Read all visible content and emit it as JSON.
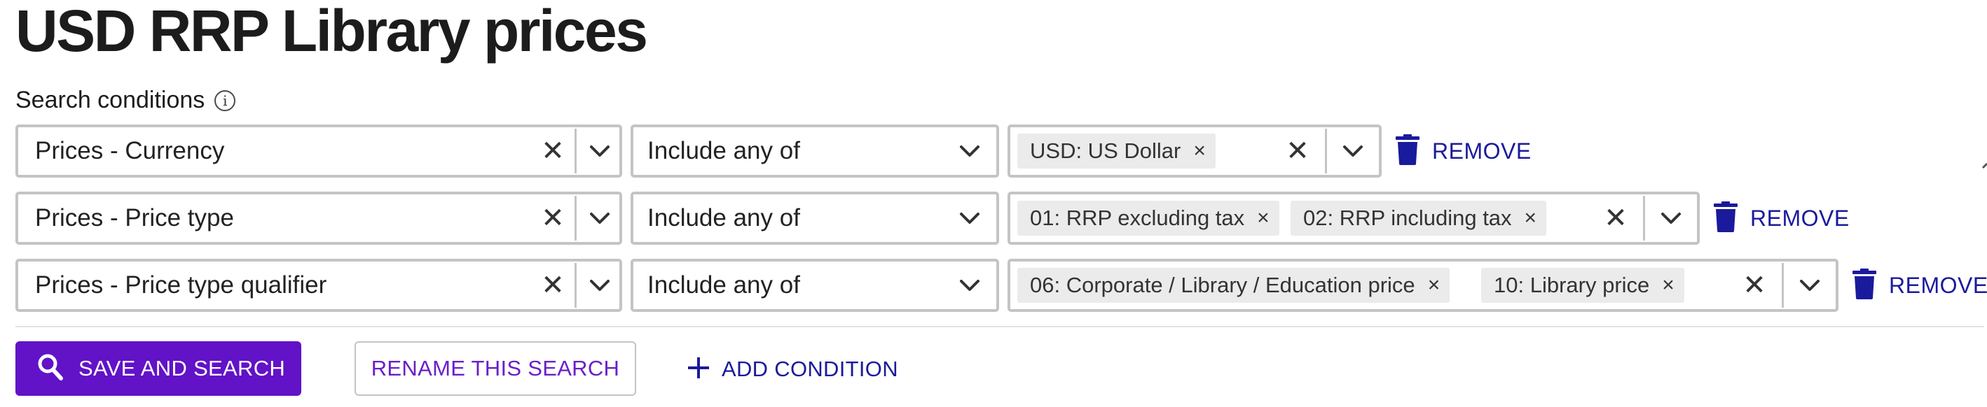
{
  "page": {
    "title": "USD RRP Library prices"
  },
  "search_conditions": {
    "label": "Search conditions",
    "info_icon": "i"
  },
  "rows": [
    {
      "field": "Prices - Currency",
      "operator": "Include any of",
      "chips": [
        "USD: US Dollar"
      ],
      "remove_label": "REMOVE"
    },
    {
      "field": "Prices - Price type",
      "operator": "Include any of",
      "chips": [
        "01: RRP excluding tax",
        "02: RRP including tax"
      ],
      "remove_label": "REMOVE"
    },
    {
      "field": "Prices - Price type qualifier",
      "operator": "Include any of",
      "chips": [
        "06: Corporate / Library / Education price",
        "10: Library price"
      ],
      "remove_label": "REMOVE"
    }
  ],
  "actions": {
    "save_and_search": "SAVE AND SEARCH",
    "rename": "RENAME THIS SEARCH",
    "add_condition": "ADD CONDITION"
  },
  "glyphs": {
    "clear": "✕",
    "chip_remove": "×"
  },
  "colors": {
    "primary": "#6212c7",
    "link": "#1a1a9c",
    "border": "#c4c4c4",
    "chip_bg": "#ebebeb"
  },
  "icons": [
    "info-icon",
    "clear-icon",
    "chevron-down-icon",
    "trash-icon",
    "search-icon",
    "plus-icon"
  ]
}
